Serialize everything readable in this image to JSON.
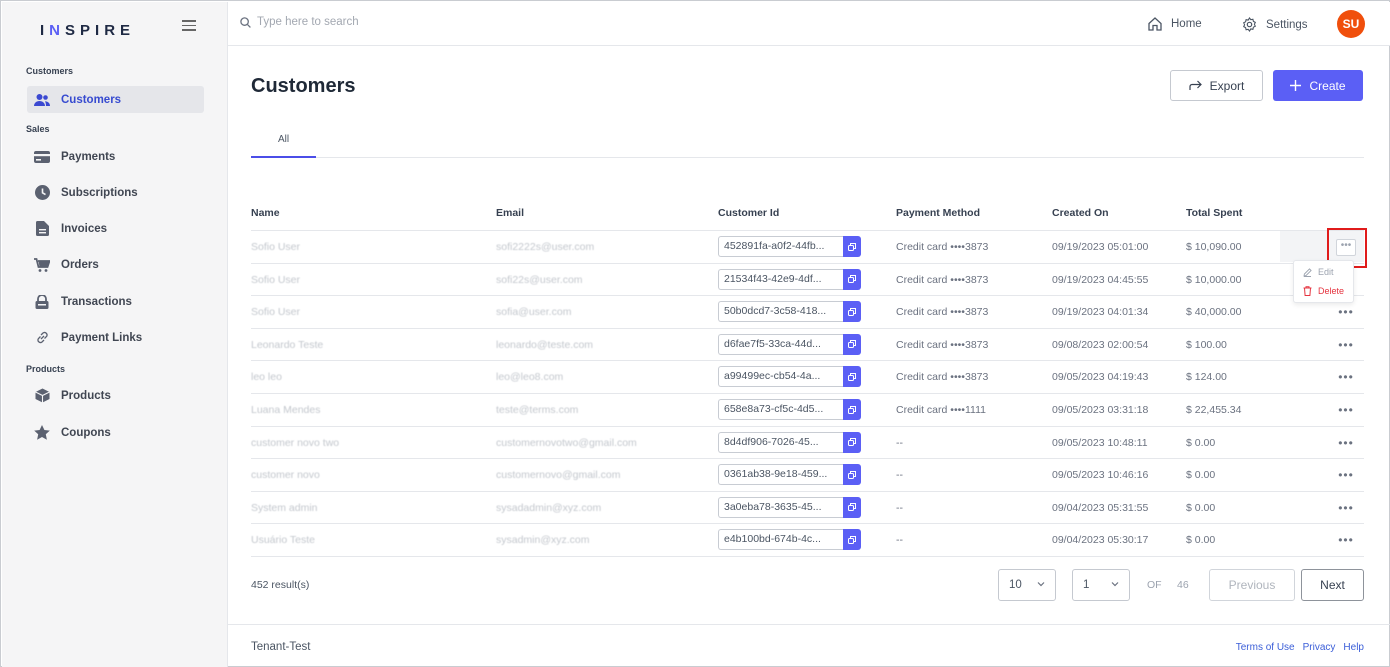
{
  "app": {
    "logo_pre": "I",
    "logo_accent": "N",
    "logo_post": "SPIRE"
  },
  "sidebar": {
    "sections": [
      {
        "label": "Customers",
        "items": [
          {
            "label": "Customers",
            "icon": "users-icon",
            "active": true
          }
        ]
      },
      {
        "label": "Sales",
        "items": [
          {
            "label": "Payments",
            "icon": "credit-card-icon"
          },
          {
            "label": "Subscriptions",
            "icon": "clock-icon"
          },
          {
            "label": "Invoices",
            "icon": "document-icon"
          },
          {
            "label": "Orders",
            "icon": "cart-icon"
          },
          {
            "label": "Transactions",
            "icon": "lock-icon"
          },
          {
            "label": "Payment Links",
            "icon": "link-icon"
          }
        ]
      },
      {
        "label": "Products",
        "items": [
          {
            "label": "Products",
            "icon": "box-icon"
          },
          {
            "label": "Coupons",
            "icon": "star-icon"
          }
        ]
      }
    ]
  },
  "topbar": {
    "search_placeholder": "Type here to search",
    "home_label": "Home",
    "settings_label": "Settings",
    "avatar_initials": "SU"
  },
  "main": {
    "title": "Customers",
    "export_label": "Export",
    "create_label": "Create",
    "tabs": [
      {
        "label": "All",
        "active": true
      }
    ],
    "columns": [
      "Name",
      "Email",
      "Customer Id",
      "Payment Method",
      "Created On",
      "Total Spent"
    ],
    "rows": [
      {
        "name": "Sofio User",
        "email": "sofi2222s@user.com",
        "customer_id": "452891fa-a0f2-44fb...",
        "payment_method": "Credit card ••••3873",
        "created_on": "09/19/2023 05:01:00",
        "total_spent": "$ 10,090.00"
      },
      {
        "name": "Sofio User",
        "email": "sofi22s@user.com",
        "customer_id": "21534f43-42e9-4df...",
        "payment_method": "Credit card ••••3873",
        "created_on": "09/19/2023 04:45:55",
        "total_spent": "$ 10,000.00"
      },
      {
        "name": "Sofio User",
        "email": "sofia@user.com",
        "customer_id": "50b0dcd7-3c58-418...",
        "payment_method": "Credit card ••••3873",
        "created_on": "09/19/2023 04:01:34",
        "total_spent": "$ 40,000.00"
      },
      {
        "name": "Leonardo Teste",
        "email": "leonardo@teste.com",
        "customer_id": "d6fae7f5-33ca-44d...",
        "payment_method": "Credit card ••••3873",
        "created_on": "09/08/2023 02:00:54",
        "total_spent": "$ 100.00"
      },
      {
        "name": "leo leo",
        "email": "leo@leo8.com",
        "customer_id": "a99499ec-cb54-4a...",
        "payment_method": "Credit card ••••3873",
        "created_on": "09/05/2023 04:19:43",
        "total_spent": "$ 124.00"
      },
      {
        "name": "Luana Mendes",
        "email": "teste@terms.com",
        "customer_id": "658e8a73-cf5c-4d5...",
        "payment_method": "Credit card ••••1111",
        "created_on": "09/05/2023 03:31:18",
        "total_spent": "$ 22,455.34"
      },
      {
        "name": "customer novo two",
        "email": "customernovotwo@gmail.com",
        "customer_id": "8d4df906-7026-45...",
        "payment_method": "--",
        "created_on": "09/05/2023 10:48:11",
        "total_spent": "$ 0.00"
      },
      {
        "name": "customer novo",
        "email": "customernovo@gmail.com",
        "customer_id": "0361ab38-9e18-459...",
        "payment_method": "--",
        "created_on": "09/05/2023 10:46:16",
        "total_spent": "$ 0.00"
      },
      {
        "name": "System admin",
        "email": "sysadadmin@xyz.com",
        "customer_id": "3a0eba78-3635-45...",
        "payment_method": "--",
        "created_on": "09/04/2023 05:31:55",
        "total_spent": "$ 0.00"
      },
      {
        "name": "Usuário Teste",
        "email": "sysadmin@xyz.com",
        "customer_id": "e4b100bd-674b-4c...",
        "payment_method": "--",
        "created_on": "09/04/2023 05:30:17",
        "total_spent": "$ 0.00"
      }
    ],
    "row_menu": {
      "edit_label": "Edit",
      "delete_label": "Delete"
    },
    "row_actions_glyph": "•••",
    "results_label": "452 result(s)",
    "pagination": {
      "page_size": "10",
      "page": "1",
      "of_label": "OF",
      "total_pages": "46",
      "prev_label": "Previous",
      "next_label": "Next"
    }
  },
  "footer": {
    "tenant": "Tenant-Test",
    "links": [
      "Terms of Use",
      "Privacy",
      "Help"
    ]
  },
  "colors": {
    "accent": "#5b5ff5",
    "avatar": "#f04f0c",
    "highlight_box": "#e01b1b",
    "delete": "#e5333f"
  }
}
